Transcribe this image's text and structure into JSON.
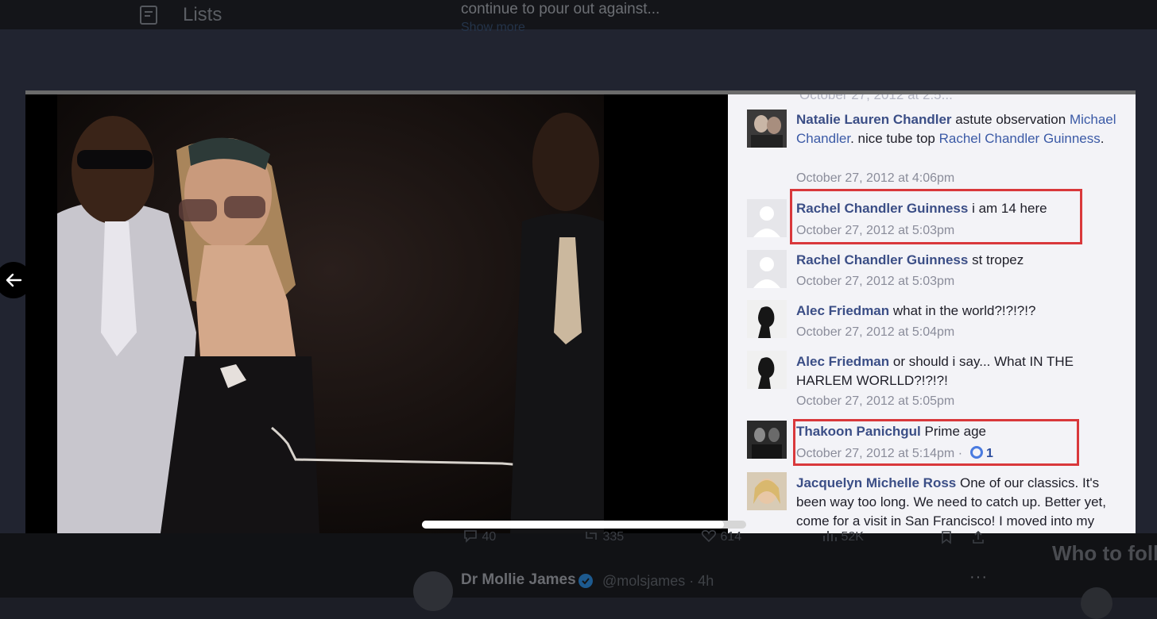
{
  "background": {
    "nav_lists_label": "Lists",
    "tweet_snippet": "continue to pour out against...",
    "show_more": "Show more",
    "stats": {
      "replies": "40",
      "retweets": "335",
      "likes": "614",
      "views": "52K"
    },
    "who_to_follow": "Who to foll",
    "reply": {
      "name": "Dr Mollie James",
      "handle": "@molsjames · 4h",
      "more": "···"
    }
  },
  "comments": {
    "top_cut": "October 27, 2012 at 2:5...",
    "items": [
      {
        "name": "Natalie Lauren Chandler",
        "text": " astute observation ",
        "link1": "Michael Chandler",
        "text2": ". nice tube top ",
        "link2": "Rachel Chandler Guinness",
        "text3": ".",
        "date": "October 27, 2012 at 4:06pm"
      },
      {
        "name": "Rachel Chandler Guinness",
        "text": " i am 14 here",
        "date": "October 27, 2012 at 5:03pm"
      },
      {
        "name": "Rachel Chandler Guinness",
        "text": " st tropez",
        "date": "October 27, 2012 at 5:03pm"
      },
      {
        "name": "Alec Friedman",
        "text": " what in the world?!?!?!?",
        "date": "October 27, 2012 at 5:04pm"
      },
      {
        "name": "Alec Friedman",
        "text": " or should i say... What IN THE HARLEM WORLLD?!?!?!",
        "date": "October 27, 2012 at 5:05pm"
      },
      {
        "name": "Thakoon Panichgul",
        "text": " Prime age",
        "date": "October 27, 2012 at 5:14pm ·",
        "likes": "1"
      },
      {
        "name": "Jacquelyn Michelle Ross",
        "text": " One of our classics. It's been way too long. We need to catch up. Better yet, come for a visit in San Francisco! I moved into my"
      }
    ]
  },
  "colors": {
    "highlight": "#d9383b",
    "link": "#3b4e86",
    "page_bg": "#212430"
  }
}
